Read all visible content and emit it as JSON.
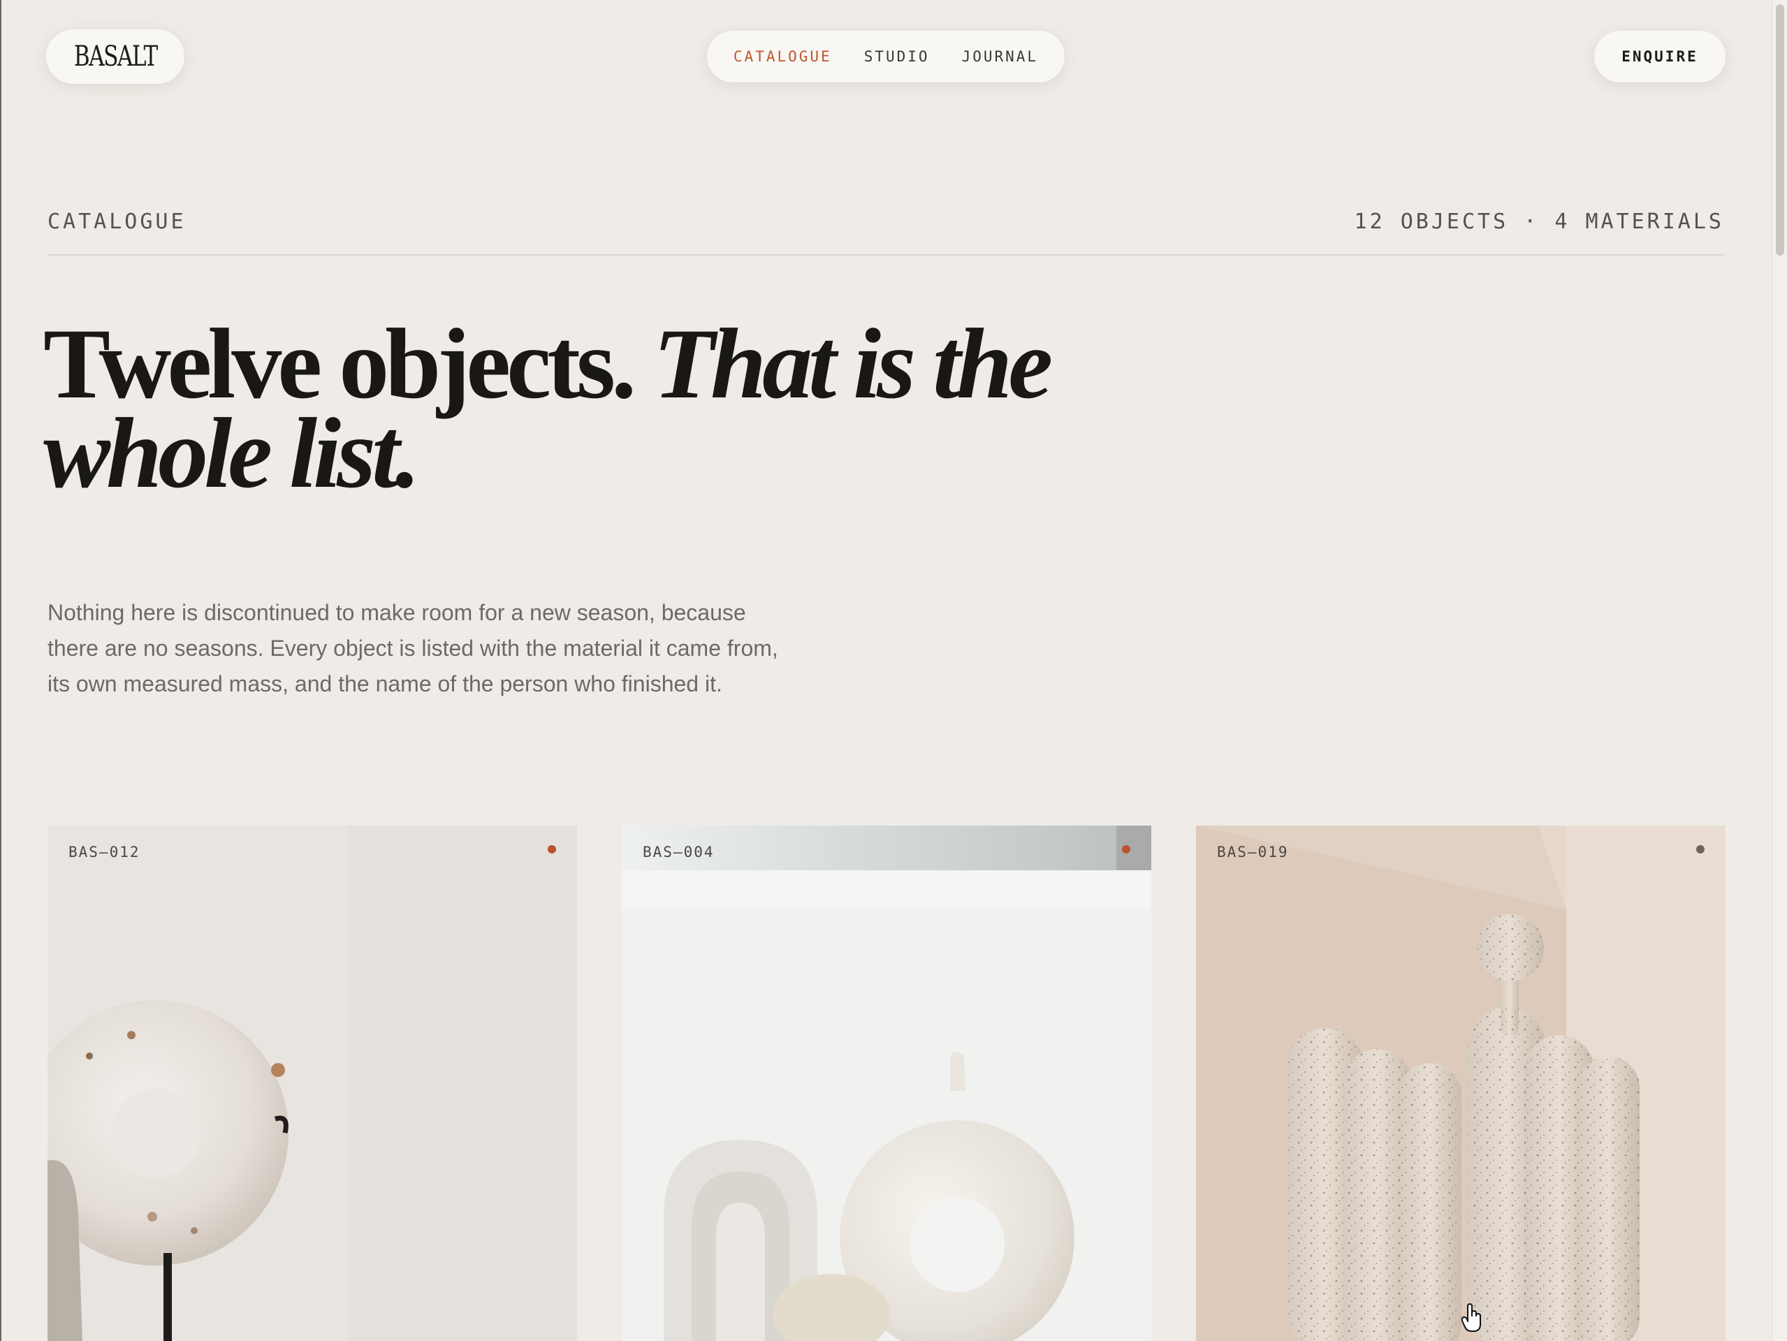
{
  "brand": {
    "logo": "BASALT"
  },
  "nav": {
    "items": [
      {
        "label": "CATALOGUE",
        "active": true
      },
      {
        "label": "STUDIO",
        "active": false
      },
      {
        "label": "JOURNAL",
        "active": false
      }
    ],
    "active_color": "#c0572e"
  },
  "enquire": {
    "label": "ENQUIRE"
  },
  "section": {
    "label": "CATALOGUE",
    "meta": "12 OBJECTS · 4 MATERIALS"
  },
  "hero": {
    "headline_plain": "Twelve objects.",
    "headline_italic": "That is the whole list.",
    "intro": "Nothing here is discontinued to make room for a new season, because there are no seasons. Every object is listed with the material it came from, its own measured mass, and the name of the person who finished it."
  },
  "products": [
    {
      "code": "BAS—012",
      "dot_color": "#b9532f"
    },
    {
      "code": "BAS—004",
      "dot_color": "#b9532f"
    },
    {
      "code": "BAS—019",
      "dot_color": "#6a6560"
    }
  ]
}
